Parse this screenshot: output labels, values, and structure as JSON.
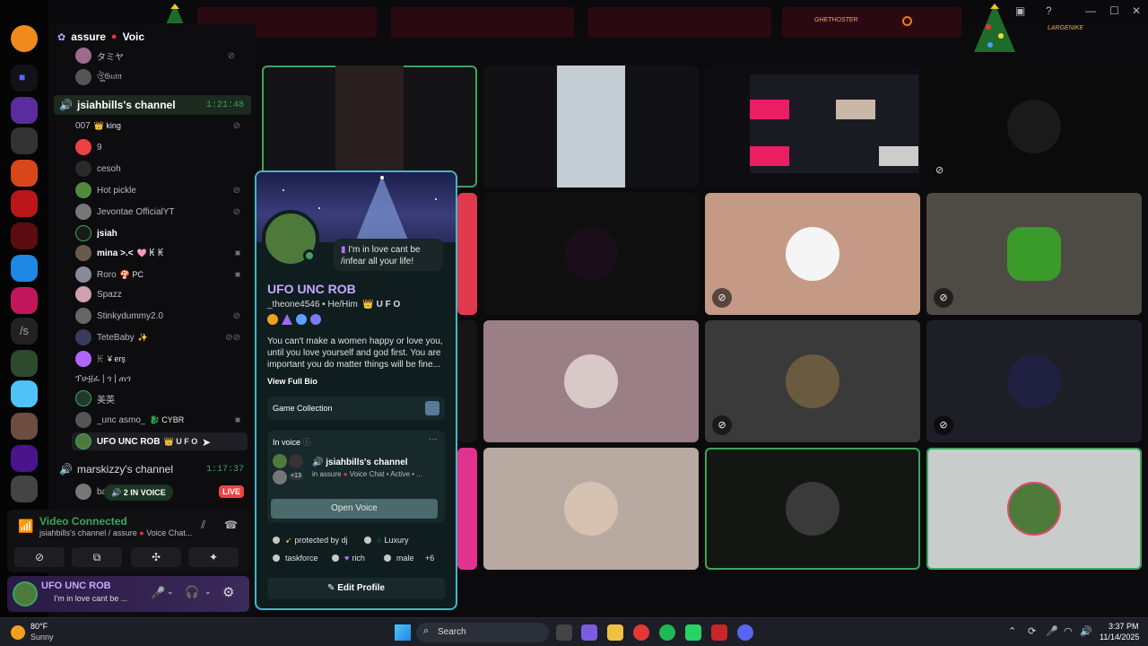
{
  "window": {
    "server_name": "assure",
    "server_channel_suffix": "Voic",
    "title_banner_text_1": "GHETHOSTER",
    "title_banner_text_2": "LARGENIKE"
  },
  "sidebar": {
    "top_members": [
      {
        "name": "タミヤ",
        "tag": ""
      },
      {
        "name": "ঔৣ𝔊𝔲𝔦𝔫",
        "tag": ""
      }
    ],
    "channel1": {
      "name": "jsiahbills's channel",
      "time": "1:21:48",
      "members": [
        {
          "name": "007",
          "tag": "king"
        },
        {
          "name": "9",
          "tag": ""
        },
        {
          "name": "cesoh",
          "tag": ""
        },
        {
          "name": "Hot pickle",
          "tag": ""
        },
        {
          "name": "Jevontae OfficialYT",
          "tag": ""
        },
        {
          "name": "jsiah",
          "tag": ""
        },
        {
          "name": "mina >.<",
          "tag": "🩷 ꀘ ꀘ"
        },
        {
          "name": "Roro",
          "tag": "PC"
        },
        {
          "name": "Spazz",
          "tag": ""
        },
        {
          "name": "Stinkydummy2.0",
          "tag": ""
        },
        {
          "name": "TeteBaby",
          "tag": "✨"
        },
        {
          "name": "ꀘ",
          "tag": "¥ erş"
        },
        {
          "name": "ፕሁ፱ፈ | ጎ | ጠጎ",
          "tag": ""
        },
        {
          "name": "美英",
          "tag": ""
        },
        {
          "name": "_unc asmo_",
          "tag": "CYBR"
        },
        {
          "name": "UFO UNC ROB",
          "tag": "U F O"
        }
      ]
    },
    "channel2": {
      "name": "marskizzy's channel",
      "time": "1:17:37",
      "in_voice": "2 IN VOICE",
      "live": "LIVE",
      "member_partial": "ba"
    }
  },
  "voice_panel": {
    "status": "Video Connected",
    "detail": "jsiahbills's channel / assure",
    "detail_suffix": "Voice Chat..."
  },
  "user_panel": {
    "name": "UFO UNC ROB",
    "status": "I'm in love cant be ..."
  },
  "popout": {
    "status_text": "I'm in love cant be /infear all your life!",
    "display_name": "UFO UNC ROB",
    "username": "_theone4546",
    "pronouns": "He/Him",
    "guild_tag": "U F O",
    "bio": "You can't make a women happy or love you, until you love yourself and god first.  You are important you do matter things will be fine...",
    "view_full_bio": "View Full Bio",
    "game_collection": "Game Collection",
    "in_voice_label": "In voice",
    "in_voice_more": "···",
    "in_voice_channel": "jsiahbills's channel",
    "in_voice_detail": "in assure",
    "in_voice_detail_suffix": "Voice Chat • Active • ...",
    "extra_count": "+13",
    "open_voice": "Open Voice",
    "roles": [
      {
        "label": "protected by dj"
      },
      {
        "label": "Luxury"
      },
      {
        "label": "taskforce"
      },
      {
        "label": "rich"
      },
      {
        "label": "male"
      }
    ],
    "roles_more": "+6",
    "edit_profile": "Edit Profile"
  },
  "video_tiles": [
    {
      "id": "t1",
      "speaking": true,
      "muted": false
    },
    {
      "id": "t2",
      "speaking": false,
      "muted": false
    },
    {
      "id": "t3",
      "speaking": false,
      "muted": false
    },
    {
      "id": "t4",
      "speaking": false,
      "muted": true
    },
    {
      "id": "t5",
      "speaking": false,
      "muted": false
    },
    {
      "id": "t6",
      "speaking": false,
      "muted": true
    },
    {
      "id": "t7",
      "speaking": false,
      "muted": true
    },
    {
      "id": "t8",
      "speaking": false,
      "muted": false
    },
    {
      "id": "t9",
      "speaking": false,
      "muted": true
    },
    {
      "id": "t10",
      "speaking": false,
      "muted": true
    },
    {
      "id": "t11",
      "speaking": false,
      "muted": false
    },
    {
      "id": "t12",
      "speaking": true,
      "muted": false
    },
    {
      "id": "t13",
      "speaking": true,
      "muted": false
    }
  ],
  "taskbar": {
    "weather_temp": "80°F",
    "weather_desc": "Sunny",
    "search_label": "Search",
    "time": "3:37 PM",
    "date": "11/14/2025"
  },
  "colors": {
    "speaking_outline": "#3ba55d",
    "popout_border": "#3fb9c7",
    "live_badge": "#ed4245"
  }
}
